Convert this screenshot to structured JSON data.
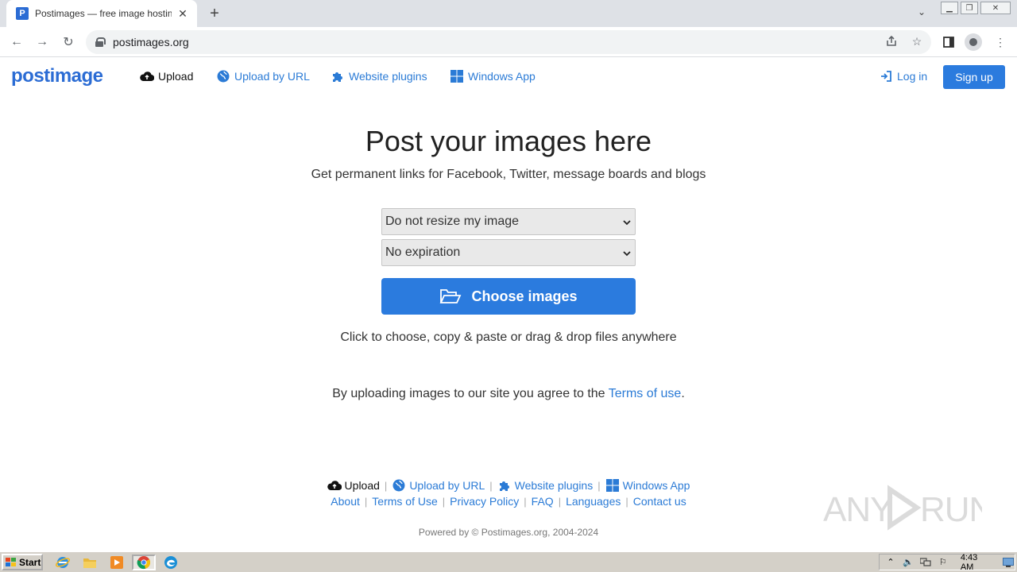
{
  "browser": {
    "tab_title": "Postimages — free image hosting / i",
    "url": "postimages.org"
  },
  "nav": {
    "logo": "postimage",
    "upload": "Upload",
    "upload_by_url": "Upload by URL",
    "website_plugins": "Website plugins",
    "windows_app": "Windows App",
    "log_in": "Log in",
    "sign_up": "Sign up"
  },
  "main": {
    "title": "Post your images here",
    "subtitle": "Get permanent links for Facebook, Twitter, message boards and blogs",
    "resize_select": "Do not resize my image",
    "expiration_select": "No expiration",
    "choose_button": "Choose images",
    "hint": "Click to choose, copy & paste or drag & drop files anywhere",
    "agree_prefix": "By uploading images to our site you agree to the ",
    "agree_link": "Terms of use",
    "agree_suffix": "."
  },
  "footer": {
    "row1": [
      "Upload",
      "Upload by URL",
      "Website plugins",
      "Windows App"
    ],
    "row2": [
      "About",
      "Terms of Use",
      "Privacy Policy",
      "FAQ",
      "Languages",
      "Contact us"
    ],
    "powered": "Powered by © Postimages.org, 2004-2024"
  },
  "watermark": "ANY RUN",
  "taskbar": {
    "start": "Start",
    "clock": "4:43 AM"
  },
  "colors": {
    "accent": "#2b7bde",
    "link": "#2b7bd6",
    "taskbar": "#d4d0c8"
  }
}
